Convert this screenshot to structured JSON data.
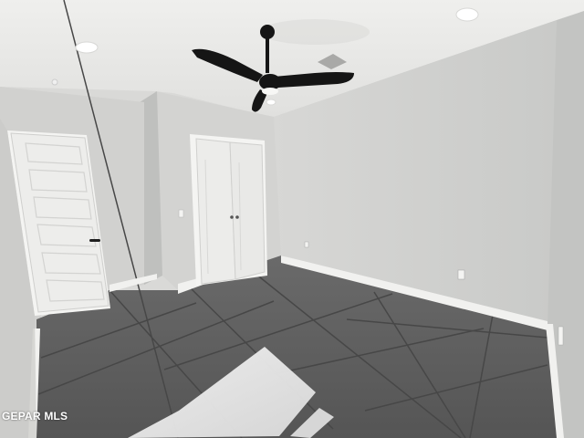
{
  "photo": {
    "subject": "empty-bedroom",
    "watermark": "GEPAR MLS"
  },
  "colors": {
    "ceiling": "#e7e7e5",
    "wall_left": "#d4d4d2",
    "wall_right": "#cfd0ce",
    "door": "#ececea",
    "floor_tile": "#5a5a5a",
    "grout": "#474747",
    "baseboard": "#f1f1ef",
    "fan": "#151515"
  }
}
